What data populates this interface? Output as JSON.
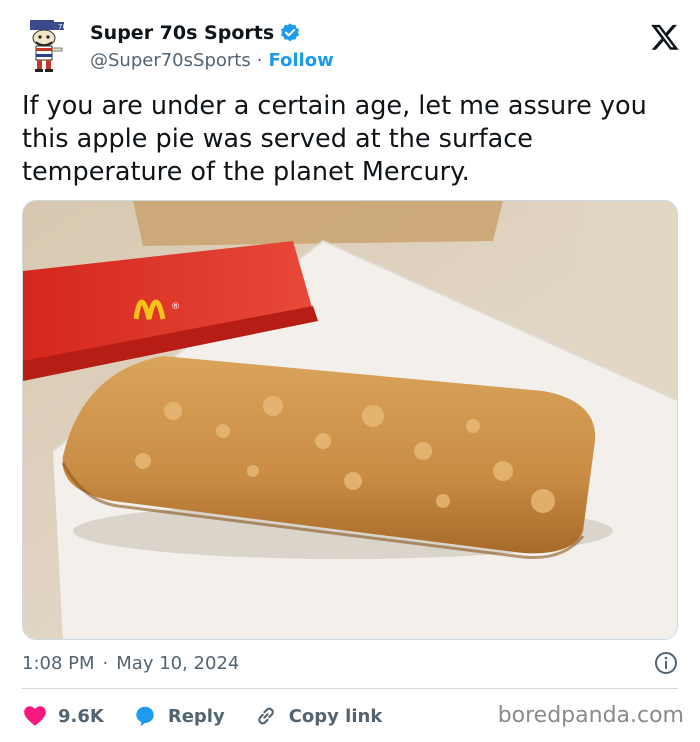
{
  "author": {
    "display_name": "Super 70s Sports",
    "handle": "@Super70sSports",
    "separator": "·",
    "follow_label": "Follow",
    "avatar_icon": "cartoon-mascot-avatar",
    "verified_icon": "verified-badge-icon"
  },
  "tweet": {
    "text": "If you are under a certain age, let me assure you this apple pie was served at the surface temperature of the planet Mercury."
  },
  "media": {
    "description_icon": "photo-apple-pie"
  },
  "meta": {
    "time": "1:08 PM",
    "separator": "·",
    "date": "May 10, 2024"
  },
  "actions": {
    "like_count": "9.6K",
    "reply_label": "Reply",
    "copy_link_label": "Copy link"
  },
  "watermark": "boredpanda.com",
  "colors": {
    "accent": "#1d9bf0",
    "like": "#f91880",
    "text_secondary": "#536471"
  }
}
